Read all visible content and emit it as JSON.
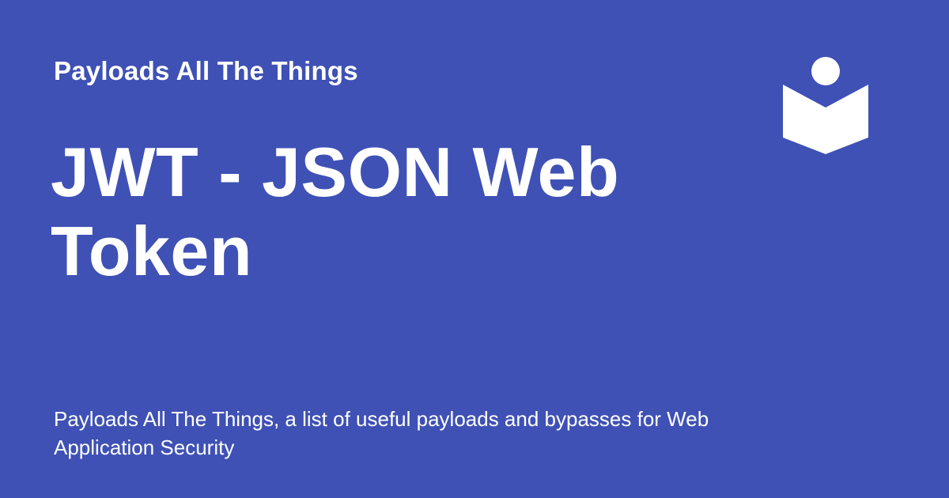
{
  "social_card": {
    "site_name": "Payloads All The Things",
    "title": "JWT - JSON Web Token",
    "description": "Payloads All The Things, a list of useful payloads and bypasses for Web Application Security",
    "logo_icon": "book-reader-icon",
    "background_color": "#3f51b5",
    "text_color": "#ffffff"
  }
}
